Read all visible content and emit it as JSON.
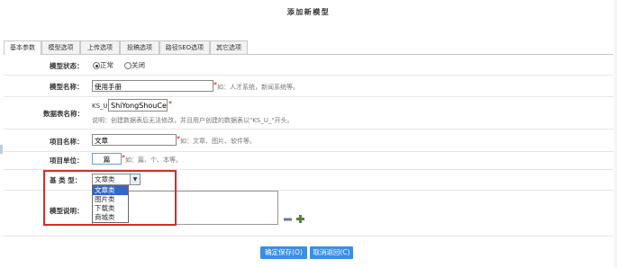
{
  "page": {
    "title": "添加新模型"
  },
  "tabs": [
    "基本参数",
    "模型选项",
    "上传选项",
    "投稿选项",
    "路径SEO选项",
    "其它选项"
  ],
  "form": {
    "status": {
      "label": "模型状态：",
      "options": [
        "正常",
        "关闭"
      ],
      "selected": 0
    },
    "name": {
      "label": "模型名称：",
      "value": "使用手册",
      "hint": "如：人才系统，新闻系统等。"
    },
    "table": {
      "label": "数据表名称：",
      "prefix": "KS_U_",
      "value": "ShiYongShouCe",
      "hint": "说明：创建数据表后无法修改，并且用户创建的数据表以\"KS_U_\"开头。"
    },
    "item_name": {
      "label": "项目名称：",
      "value": "文章",
      "hint": "如：文章、图片、软件等。"
    },
    "item_unit": {
      "label": "项目单位：",
      "value": "篇",
      "hint": "如：篇、个、本等。"
    },
    "base_type": {
      "label": "基 类 型：",
      "selected": "文章类",
      "options": [
        "文章类",
        "图片类",
        "下载类",
        "商城类"
      ]
    },
    "description": {
      "label": "模型说明：",
      "value": ""
    }
  },
  "buttons": {
    "save": "确定保存(O)",
    "cancel": "取消返回(C)"
  },
  "icons": {
    "shrink": "minus-icon",
    "expand": "plus-icon"
  },
  "colors": {
    "highlight_border": "#d62b2b",
    "button_bg": "#3a8ee6",
    "selected_option": "#3366cc"
  }
}
